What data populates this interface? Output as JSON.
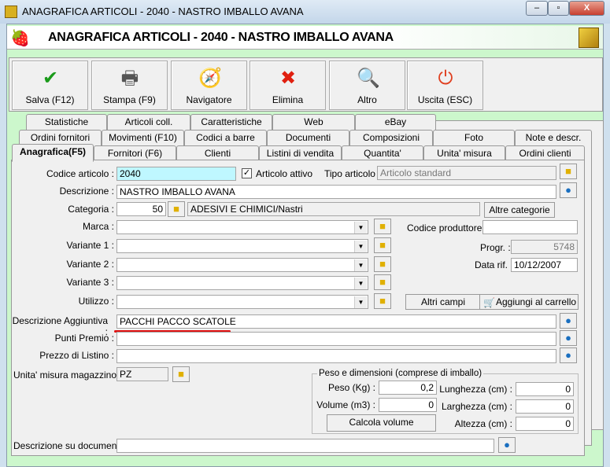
{
  "window": {
    "title": "ANAGRAFICA ARTICOLI - 2040 - NASTRO IMBALLO AVANA",
    "min": "‒",
    "max": "▫",
    "close": "X"
  },
  "header": {
    "title": "ANAGRAFICA ARTICOLI - 2040 - NASTRO IMBALLO AVANA"
  },
  "toolbar": [
    {
      "label": "Salva (F12)",
      "icon": "check-icon",
      "glyph": "✔",
      "color": "#1a9a1a"
    },
    {
      "label": "Stampa (F9)",
      "icon": "printer-icon",
      "glyph": "🖶",
      "color": "#555555"
    },
    {
      "label": "Navigatore",
      "icon": "compass-icon",
      "glyph": "🧭",
      "color": "#6a6ac0"
    },
    {
      "label": "Elimina",
      "icon": "delete-icon",
      "glyph": "✖",
      "color": "#e02010"
    },
    {
      "label": "Altro",
      "icon": "search-book-icon",
      "glyph": "🔍",
      "color": "#1a60c0"
    },
    {
      "label": "Uscita (ESC)",
      "icon": "power-icon",
      "glyph": "⏻",
      "color": "#e04020"
    }
  ],
  "tabs": {
    "row1": [
      "Statistiche",
      "Articoli coll.",
      "Caratteristiche",
      "Web",
      "eBay"
    ],
    "row2": [
      "Ordini fornitori",
      "Movimenti (F10)",
      "Codici a barre",
      "Documenti",
      "Composizioni",
      "Foto",
      "Note e descr."
    ],
    "row3": [
      "Anagrafica(F5)",
      "Fornitori (F6)",
      "Clienti",
      "Listini di vendita",
      "Quantita'",
      "Unita' misura",
      "Ordini clienti"
    ]
  },
  "form": {
    "codice_label": "Codice articolo :",
    "codice": "2040",
    "attivo_label": "Articolo attivo",
    "attivo": true,
    "attivo_mark": "✓",
    "tipo_label": "Tipo articolo :",
    "tipo": "Articolo standard",
    "descrizione_label": "Descrizione :",
    "descrizione": "NASTRO IMBALLO AVANA",
    "categoria_label": "Categoria :",
    "categoria_code": "50",
    "categoria": "ADESIVI E CHIMICI/Nastri",
    "altre_categorie": "Altre categorie",
    "marca_label": "Marca :",
    "variante1_label": "Variante 1 :",
    "variante2_label": "Variante 2 :",
    "variante3_label": "Variante 3 :",
    "utilizzo_label": "Utilizzo :",
    "codice_produttore_label": "Codice produttore :",
    "codice_produttore": "",
    "progr_label": "Progr. :",
    "progr": "5748",
    "data_rif_label": "Data rif. :",
    "data_rif": "10/12/2007",
    "altri_campi": "Altri campi",
    "aggiungi_carrello": "Aggiungi al carrello",
    "desc_agg_label": "Descrizione Aggiuntiva :",
    "desc_agg": "PACCHI PACCO SCATOLE",
    "punti_label": "Punti Premio :",
    "prezzo_label": "Prezzo di Listino :",
    "unita_label": "Unita' misura magazzino :",
    "unita": "PZ",
    "peso_group": "Peso e dimensioni (comprese di imballo)",
    "peso_label": "Peso (Kg) :",
    "peso": "0,2",
    "volume_label": "Volume (m3) :",
    "volume": "0",
    "lunghezza_label": "Lunghezza (cm) :",
    "lunghezza": "0",
    "larghezza_label": "Larghezza (cm) :",
    "larghezza": "0",
    "altezza_label": "Altezza (cm) :",
    "altezza": "0",
    "calcola": "Calcola volume",
    "desc_doc_label": "Descrizione su documenti:",
    "desc_doc": ""
  }
}
